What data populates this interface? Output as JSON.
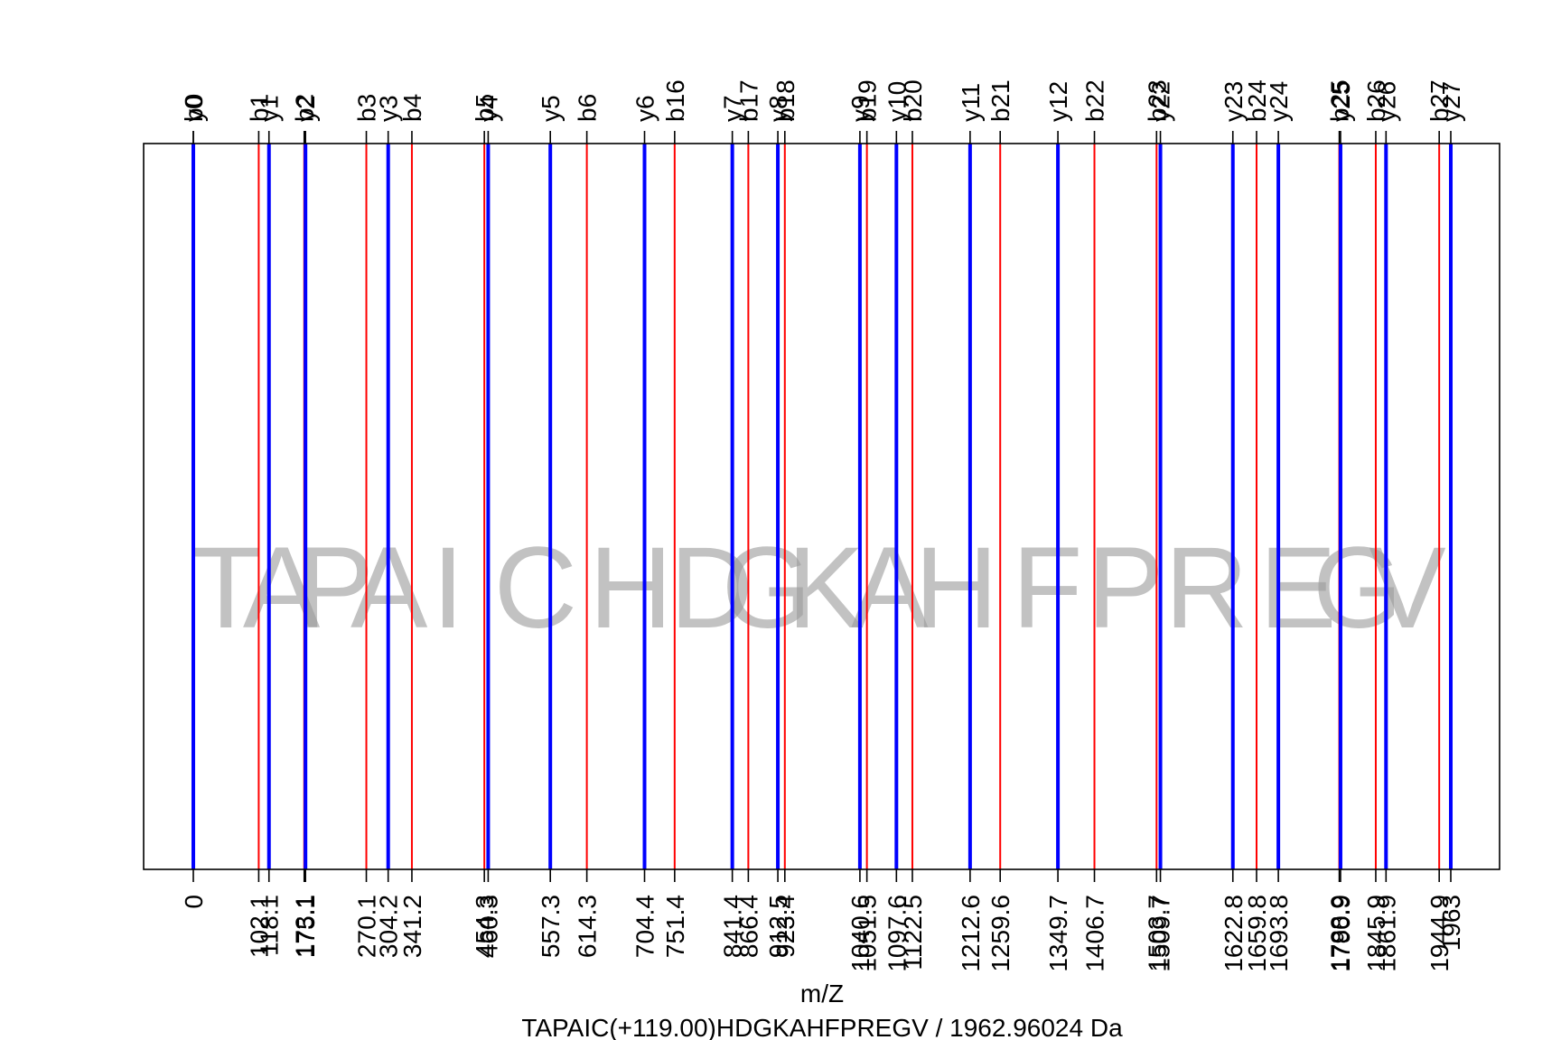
{
  "chart_data": {
    "type": "spectrum-fragment-map",
    "xlabel": "m/Z",
    "title": "TAPAIC(+119.00)HDGKAHFPREGV / 1962.96024 Da",
    "xlim": [
      0,
      1963
    ],
    "sequence": [
      "T",
      "A",
      "P",
      "A",
      "I",
      "C",
      "H",
      "D",
      "G",
      "K",
      "A",
      "H",
      "F",
      "P",
      "R",
      "E",
      "G",
      "V"
    ],
    "series": [
      {
        "name": "b",
        "color": "#ff0000",
        "ions": [
          {
            "label": "b0",
            "mz": 0
          },
          {
            "label": "b1",
            "mz": 102.1
          },
          {
            "label": "b2",
            "mz": 173.1
          },
          {
            "label": "b3",
            "mz": 270.1
          },
          {
            "label": "b4",
            "mz": 341.2
          },
          {
            "label": "b5",
            "mz": 454.3
          },
          {
            "label": "b6",
            "mz": 614.3
          },
          {
            "label": "b16",
            "mz": 751.4
          },
          {
            "label": "b17",
            "mz": 866.4
          },
          {
            "label": "b18",
            "mz": 923.4
          },
          {
            "label": "b19",
            "mz": 1051.5
          },
          {
            "label": "b20",
            "mz": 1122.5
          },
          {
            "label": "b21",
            "mz": 1259.6
          },
          {
            "label": "b22",
            "mz": 1406.7
          },
          {
            "label": "b23",
            "mz": 1503.7
          },
          {
            "label": "b24",
            "mz": 1659.8
          },
          {
            "label": "b25",
            "mz": 1788.9
          },
          {
            "label": "b26",
            "mz": 1845.9
          },
          {
            "label": "b27",
            "mz": 1944.9
          }
        ]
      },
      {
        "name": "y",
        "color": "#0000ff",
        "ions": [
          {
            "label": "y0",
            "mz": 0
          },
          {
            "label": "y1",
            "mz": 118.1
          },
          {
            "label": "y2",
            "mz": 175.1
          },
          {
            "label": "y3",
            "mz": 304.2
          },
          {
            "label": "y4",
            "mz": 460.3
          },
          {
            "label": "y5",
            "mz": 557.3
          },
          {
            "label": "y6",
            "mz": 704.4
          },
          {
            "label": "y7",
            "mz": 841.4
          },
          {
            "label": "y8",
            "mz": 912.5
          },
          {
            "label": "y9",
            "mz": 1040.6
          },
          {
            "label": "y10",
            "mz": 1097.6
          },
          {
            "label": "y11",
            "mz": 1212.6
          },
          {
            "label": "y12",
            "mz": 1349.7
          },
          {
            "label": "y22",
            "mz": 1509.7
          },
          {
            "label": "y23",
            "mz": 1622.8
          },
          {
            "label": "y24",
            "mz": 1693.8
          },
          {
            "label": "y25",
            "mz": 1790.9
          },
          {
            "label": "y26",
            "mz": 1861.9
          },
          {
            "label": "y27",
            "mz": 1963
          }
        ]
      }
    ],
    "tick_labels": [
      "0",
      "102.1",
      "118.1",
      "173.1",
      "175.1",
      "270.1",
      "304.2",
      "341.2",
      "454.3",
      "460.3",
      "557.3",
      "614.3",
      "704.4",
      "751.4",
      "841.4",
      "866.4",
      "912.5",
      "923.4",
      "1040.6",
      "1051.5",
      "1097.6",
      "1122.5",
      "1212.6",
      "1259.6",
      "1349.7",
      "1406.7",
      "1503.7",
      "1509.7",
      "1622.8",
      "1659.8",
      "1693.8",
      "1788.9",
      "1790.9",
      "1845.9",
      "1861.9",
      "1944.9",
      "1963"
    ],
    "grid": false,
    "legend": "none"
  }
}
